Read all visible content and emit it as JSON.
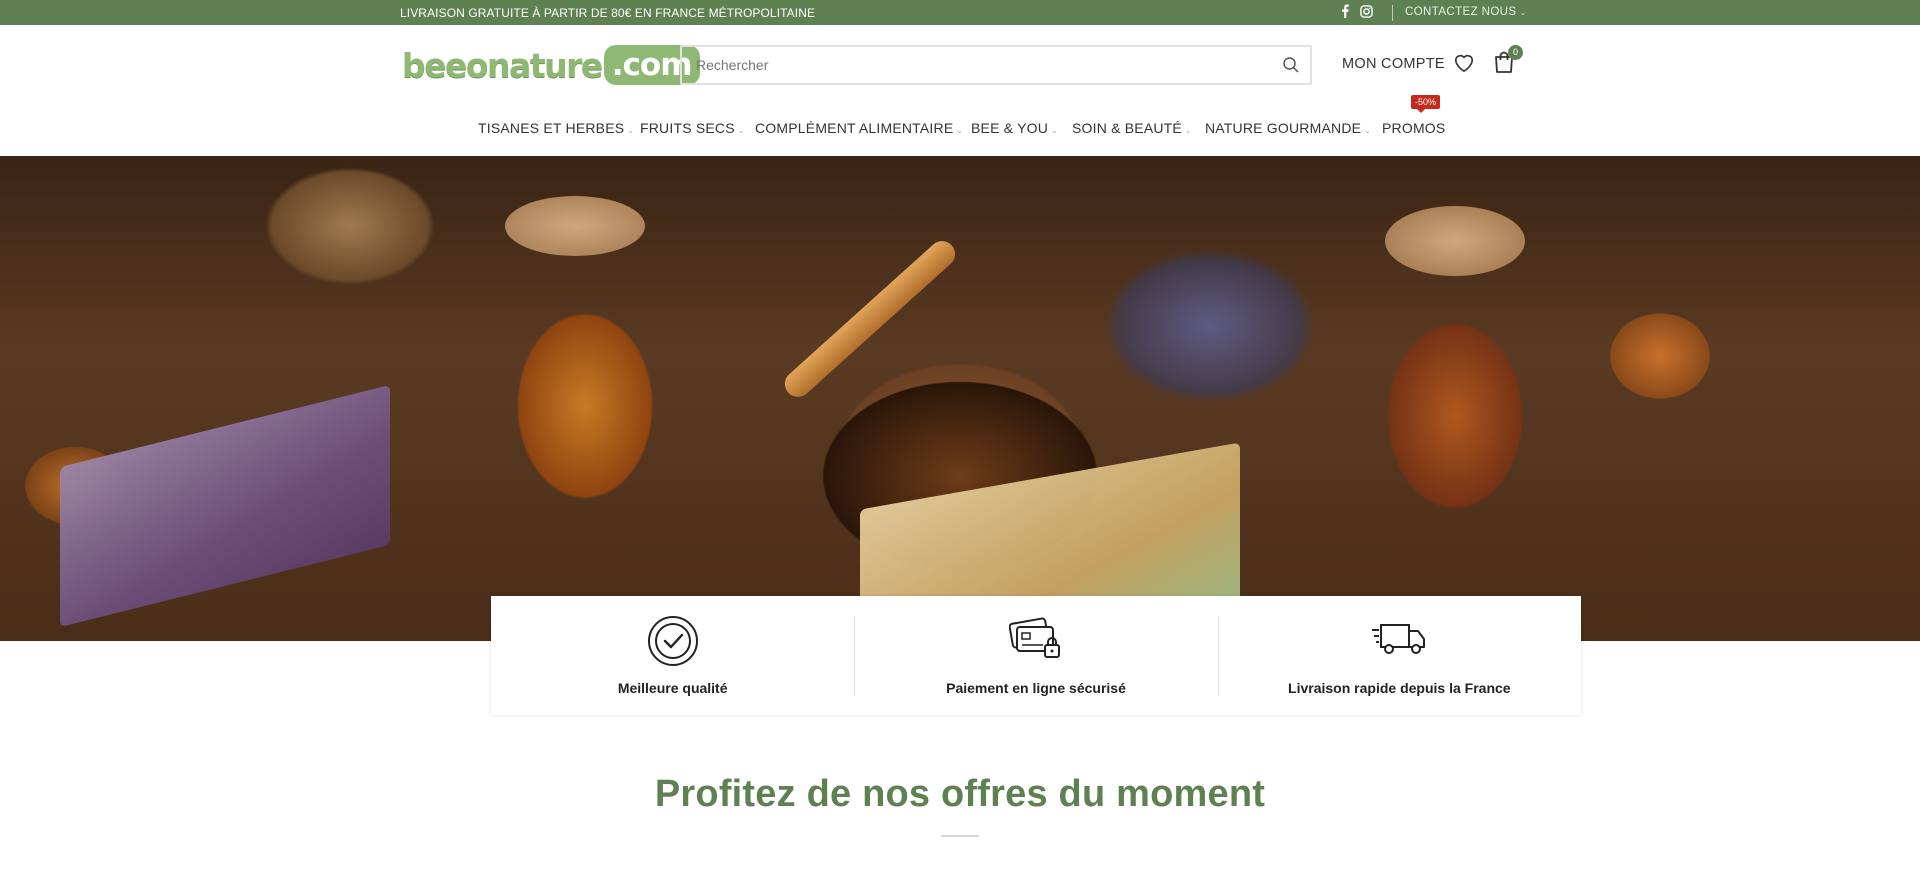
{
  "topbar": {
    "promo_text": "LIVRAISON GRATUITE À PARTIR DE 80€ EN FRANCE MÉTROPOLITAINE",
    "social_icons": [
      "facebook-icon",
      "instagram-icon"
    ],
    "contact_label": "CONTACTEZ NOUS",
    "bg_color": "#5f8152"
  },
  "header": {
    "logo_text": "beeonature",
    "logo_suffix": ".com",
    "search_placeholder": "Rechercher",
    "account_label": "MON COMPTE",
    "cart_count": "0"
  },
  "nav": {
    "items": [
      {
        "label": "TISANES ET HERBES"
      },
      {
        "label": "FRUITS SECS"
      },
      {
        "label": "COMPLÉMENT ALIMENTAIRE"
      },
      {
        "label": "BEE & YOU"
      },
      {
        "label": "SOIN & BEAUTÉ"
      },
      {
        "label": "NATURE GOURMANDE"
      },
      {
        "label": "PROMOS"
      }
    ],
    "promo_badge": "-50%"
  },
  "features": [
    {
      "label": "Meilleure qualité",
      "icon": "quality-badge-icon"
    },
    {
      "label": "Paiement en ligne sécurisé",
      "icon": "secure-payment-icon"
    },
    {
      "label": "Livraison rapide depuis la France",
      "icon": "delivery-truck-icon"
    }
  ],
  "section": {
    "title": "Profitez de nos offres du moment"
  },
  "colors": {
    "accent": "#5f8152",
    "logo_green": "#8eb874",
    "badge_red": "#c42b1c"
  }
}
